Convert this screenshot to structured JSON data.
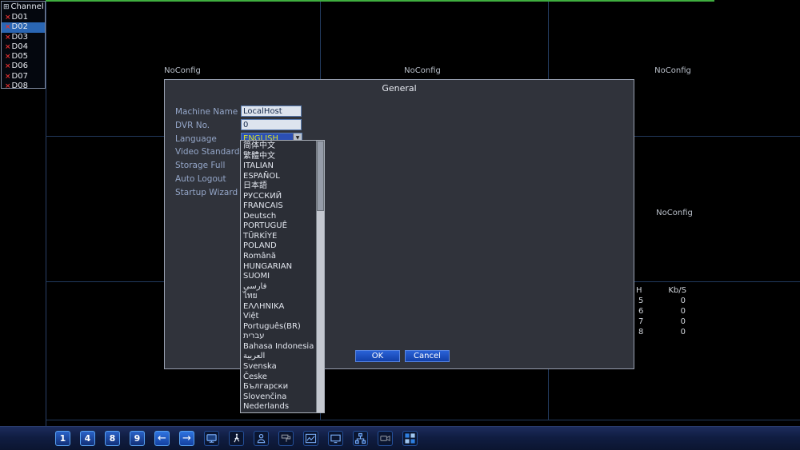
{
  "sidebar": {
    "title": "Channel",
    "items": [
      {
        "mark": "×",
        "label": "D01",
        "selected": false
      },
      {
        "mark": "×",
        "label": "D02",
        "selected": true
      },
      {
        "mark": "×",
        "label": "D03",
        "selected": false
      },
      {
        "mark": "×",
        "label": "D04",
        "selected": false
      },
      {
        "mark": "×",
        "label": "D05",
        "selected": false
      },
      {
        "mark": "×",
        "label": "D06",
        "selected": false
      },
      {
        "mark": "×",
        "label": "D07",
        "selected": false
      },
      {
        "mark": "×",
        "label": "D08",
        "selected": false
      }
    ]
  },
  "video_grid": {
    "no_config_label": "NoConfig"
  },
  "bitrate_table": {
    "col1": "H",
    "col2": "Kb/S",
    "rows": [
      {
        "ch": "5",
        "kbps": "0"
      },
      {
        "ch": "6",
        "kbps": "0"
      },
      {
        "ch": "7",
        "kbps": "0"
      },
      {
        "ch": "8",
        "kbps": "0"
      }
    ]
  },
  "dialog": {
    "title": "General",
    "fields": [
      {
        "label": "Machine Name",
        "value": "LocalHost"
      },
      {
        "label": "DVR No.",
        "value": "0"
      },
      {
        "label": "Language",
        "value": "ENGLISH"
      },
      {
        "label": "Video Standard"
      },
      {
        "label": "Storage Full"
      },
      {
        "label": "Auto Logout"
      },
      {
        "label": "Startup Wizard"
      }
    ],
    "language_options": [
      "简体中文",
      "繁體中文",
      "ITALIAN",
      "ESPAÑOL",
      "日本語",
      "РУССКИЙ",
      "FRANCAIS",
      "Deutsch",
      "PORTUGUÊ",
      "TÜRKİYE",
      "POLAND",
      "Română",
      "HUNGARIAN",
      "SUOMI",
      "فارسي",
      "ไทย",
      "ΕΛΛΗΝΙΚΑ",
      "Việt",
      "Português(BR)",
      "עברית",
      "Bahasa Indonesia",
      "العربية",
      "Svenska",
      "Česke",
      "Български",
      "Slovenčina",
      "Nederlands"
    ],
    "ok_label": "OK",
    "cancel_label": "Cancel"
  },
  "taskbar": {
    "view_buttons": [
      "1",
      "4",
      "8",
      "9"
    ],
    "prev_arrow": "←",
    "next_arrow": "→"
  },
  "colors": {
    "selected_channel_blue": "#2a66b4",
    "button_blue": "#1240a8",
    "grid_line_blue": "#223a5e",
    "active_green": "#3fae3f",
    "offline_red": "#e03030",
    "combo_highlight_text": "#d8e02a",
    "combo_highlight_bg": "#2b4fb4"
  }
}
